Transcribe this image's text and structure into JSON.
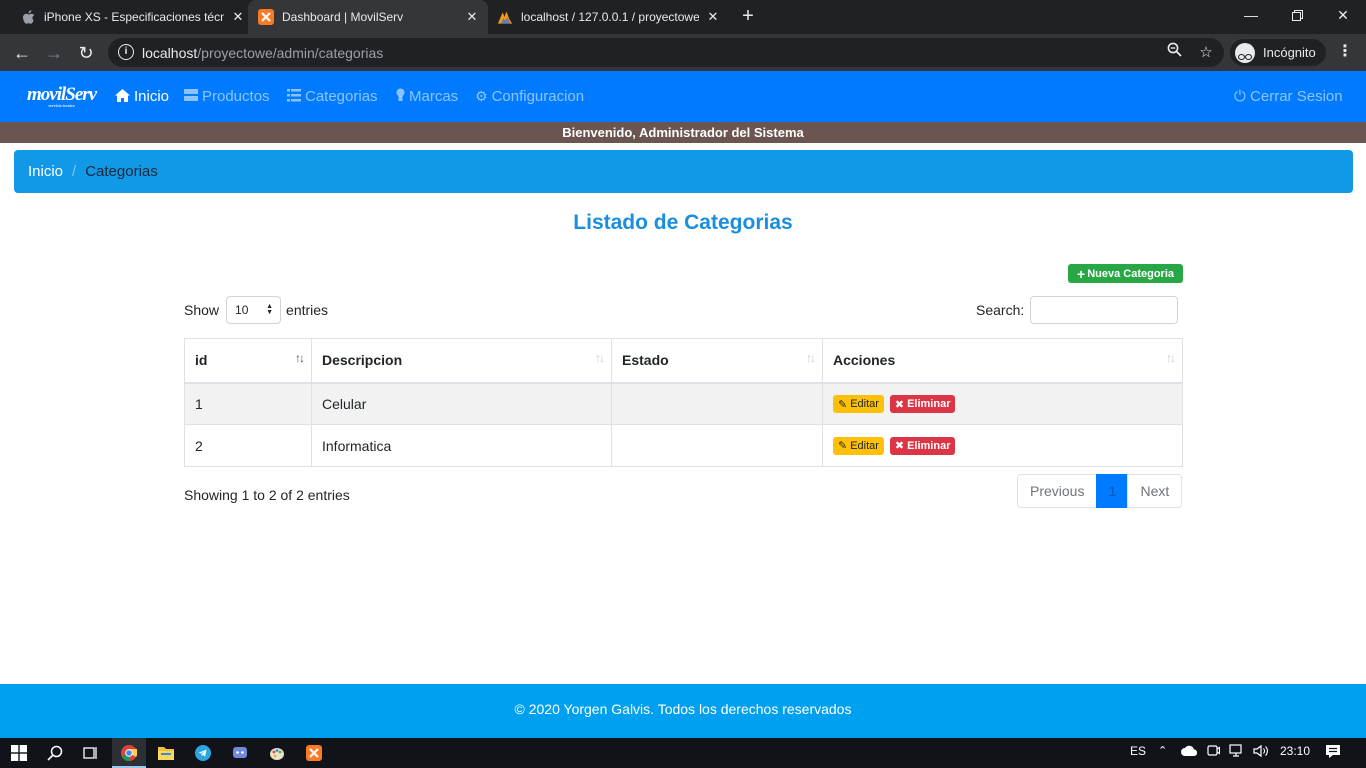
{
  "browser": {
    "tabs": [
      {
        "title": "iPhone XS - Especificaciones técnicas",
        "icon": "apple-icon"
      },
      {
        "title": "Dashboard | MovilServ",
        "icon": "xampp-icon"
      },
      {
        "title": "localhost / 127.0.0.1 / proyectowe",
        "icon": "phpmyadmin-icon"
      }
    ],
    "close_glyph": "✕",
    "new_tab_glyph": "+",
    "url_host": "localhost",
    "url_path": "/proyectowe/admin/categorias",
    "profile_label": "Incógnito"
  },
  "app": {
    "logo": "movilServ",
    "logo_tagline": "servicio tecnico",
    "nav": [
      {
        "label": "Inicio",
        "icon": "home-icon"
      },
      {
        "label": "Productos",
        "icon": "server-icon"
      },
      {
        "label": "Categorias",
        "icon": "list-icon"
      },
      {
        "label": "Marcas",
        "icon": "lightbulb-icon"
      },
      {
        "label": "Configuracion",
        "icon": "gear-icon"
      }
    ],
    "logout_label": "Cerrar Sesion",
    "welcome": "Bienvenido, Administrador del Sistema",
    "accent_color": "#007bff"
  },
  "breadcrumb": {
    "home": "Inicio",
    "separator": "/",
    "current": "Categorias"
  },
  "page": {
    "title": "Listado de Categorias",
    "new_button": "Nueva Categoria"
  },
  "datatable": {
    "length_prefix": "Show",
    "length_value": "10",
    "length_suffix": "entries",
    "search_label": "Search:",
    "search_value": "",
    "columns": [
      "id",
      "Descripcion",
      "Estado",
      "Acciones"
    ],
    "rows": [
      {
        "id": "1",
        "descripcion": "Celular",
        "estado": ""
      },
      {
        "id": "2",
        "descripcion": "Informatica",
        "estado": ""
      }
    ],
    "edit_label": "Editar",
    "delete_label": "Eliminar",
    "info": "Showing 1 to 2 of 2 entries",
    "pager": {
      "previous": "Previous",
      "current": "1",
      "next": "Next"
    }
  },
  "footer": "© 2020 Yorgen Galvis. Todos los derechos reservados",
  "taskbar": {
    "language": "ES",
    "time": "23:10"
  }
}
